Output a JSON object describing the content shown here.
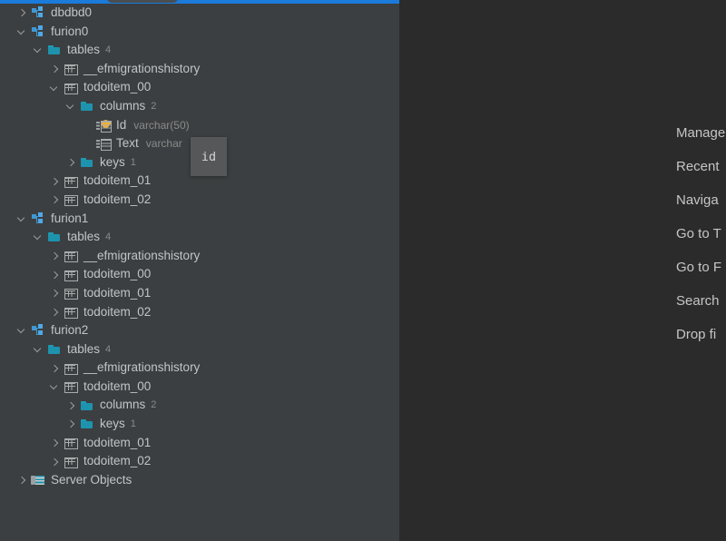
{
  "window": {
    "background_left": "#3c3f41",
    "background_right": "#2b2b2b",
    "accent": "#1a7bdb"
  },
  "tree": {
    "rows": [
      {
        "indent": 0,
        "arrow": "right",
        "icon": "schema",
        "label": "dbdbd0",
        "count": "",
        "dtype": ""
      },
      {
        "indent": 0,
        "arrow": "down",
        "icon": "schema",
        "label": "furion0",
        "count": "",
        "dtype": ""
      },
      {
        "indent": 1,
        "arrow": "down",
        "icon": "folder",
        "label": "tables",
        "count": "4",
        "dtype": ""
      },
      {
        "indent": 2,
        "arrow": "right",
        "icon": "table",
        "label": "__efmigrationshistory",
        "count": "",
        "dtype": ""
      },
      {
        "indent": 2,
        "arrow": "down",
        "icon": "table",
        "label": "todoitem_00",
        "count": "",
        "dtype": ""
      },
      {
        "indent": 3,
        "arrow": "down",
        "icon": "folder",
        "label": "columns",
        "count": "2",
        "dtype": ""
      },
      {
        "indent": 4,
        "arrow": "none",
        "icon": "column-key",
        "label": "Id",
        "count": "",
        "dtype": "varchar(50)"
      },
      {
        "indent": 4,
        "arrow": "none",
        "icon": "column",
        "label": "Text",
        "count": "",
        "dtype": "varchar"
      },
      {
        "indent": 3,
        "arrow": "right",
        "icon": "folder",
        "label": "keys",
        "count": "1",
        "dtype": ""
      },
      {
        "indent": 2,
        "arrow": "right",
        "icon": "table",
        "label": "todoitem_01",
        "count": "",
        "dtype": ""
      },
      {
        "indent": 2,
        "arrow": "right",
        "icon": "table",
        "label": "todoitem_02",
        "count": "",
        "dtype": ""
      },
      {
        "indent": 0,
        "arrow": "down",
        "icon": "schema",
        "label": "furion1",
        "count": "",
        "dtype": ""
      },
      {
        "indent": 1,
        "arrow": "down",
        "icon": "folder",
        "label": "tables",
        "count": "4",
        "dtype": ""
      },
      {
        "indent": 2,
        "arrow": "right",
        "icon": "table",
        "label": "__efmigrationshistory",
        "count": "",
        "dtype": ""
      },
      {
        "indent": 2,
        "arrow": "right",
        "icon": "table",
        "label": "todoitem_00",
        "count": "",
        "dtype": ""
      },
      {
        "indent": 2,
        "arrow": "right",
        "icon": "table",
        "label": "todoitem_01",
        "count": "",
        "dtype": ""
      },
      {
        "indent": 2,
        "arrow": "right",
        "icon": "table",
        "label": "todoitem_02",
        "count": "",
        "dtype": ""
      },
      {
        "indent": 0,
        "arrow": "down",
        "icon": "schema",
        "label": "furion2",
        "count": "",
        "dtype": ""
      },
      {
        "indent": 1,
        "arrow": "down",
        "icon": "folder",
        "label": "tables",
        "count": "4",
        "dtype": ""
      },
      {
        "indent": 2,
        "arrow": "right",
        "icon": "table",
        "label": "__efmigrationshistory",
        "count": "",
        "dtype": ""
      },
      {
        "indent": 2,
        "arrow": "down",
        "icon": "table",
        "label": "todoitem_00",
        "count": "",
        "dtype": ""
      },
      {
        "indent": 3,
        "arrow": "right",
        "icon": "folder",
        "label": "columns",
        "count": "2",
        "dtype": ""
      },
      {
        "indent": 3,
        "arrow": "right",
        "icon": "folder",
        "label": "keys",
        "count": "1",
        "dtype": ""
      },
      {
        "indent": 2,
        "arrow": "right",
        "icon": "table",
        "label": "todoitem_01",
        "count": "",
        "dtype": ""
      },
      {
        "indent": 2,
        "arrow": "right",
        "icon": "table",
        "label": "todoitem_02",
        "count": "",
        "dtype": ""
      },
      {
        "indent": 0,
        "arrow": "right",
        "icon": "server",
        "label": "Server Objects",
        "count": "",
        "dtype": ""
      }
    ]
  },
  "tooltip": {
    "text": "id"
  },
  "menu": {
    "items": [
      {
        "label": "Manage"
      },
      {
        "label": "Recent"
      },
      {
        "label": "Naviga"
      },
      {
        "label": "Go to T"
      },
      {
        "label": "Go to F"
      },
      {
        "label": "Search"
      },
      {
        "label": "Drop fi"
      }
    ]
  }
}
